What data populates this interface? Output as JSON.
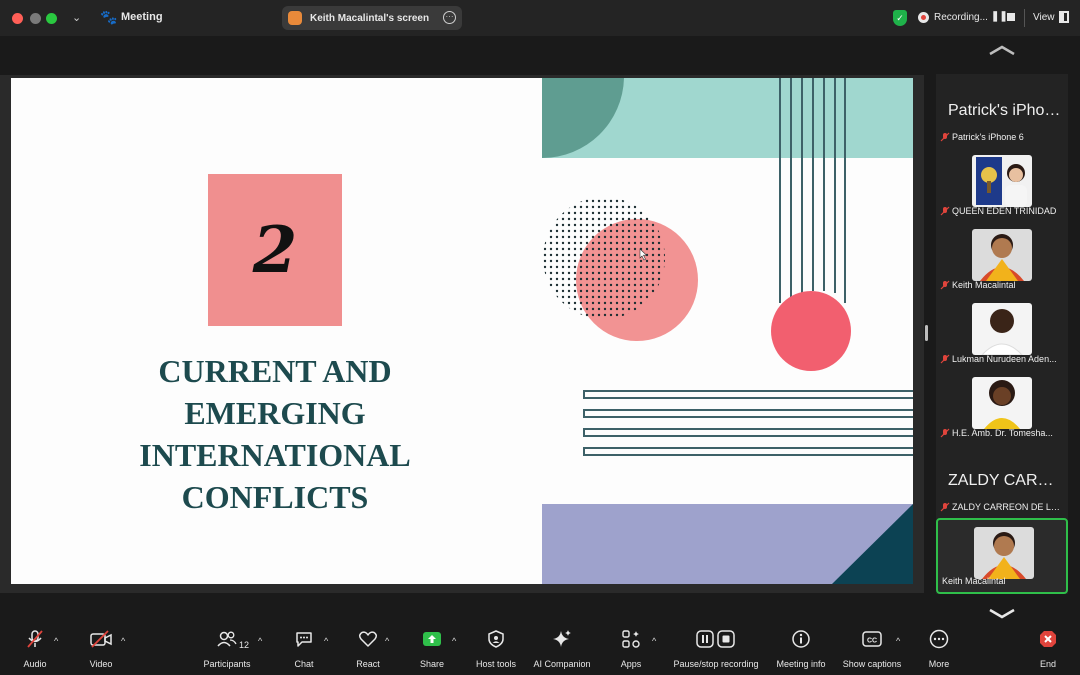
{
  "titlebar": {
    "app_title": "Meeting",
    "screen_pill_label": "Keith Macalintal's screen",
    "recording_label": "Recording...",
    "pause_glyph": "❚❚",
    "view_label": "View",
    "icons": [
      "paw-icon",
      "shield-icon",
      "record-dot-icon",
      "pause-icon",
      "stop-icon",
      "view-layout-icon",
      "more-icon"
    ]
  },
  "slide": {
    "number": "2",
    "title_lines": [
      "CURRENT AND",
      "EMERGING",
      "INTERNATIONAL",
      "CONFLICTS"
    ],
    "colors": {
      "teal_light": "#a0d7cf",
      "teal_dark": "#5f9d91",
      "salmon": "#f29393",
      "coral": "#f25f6f",
      "lavender": "#9ea2cc",
      "navy": "#0c4253",
      "line": "#3d6168",
      "title": "#1d4a4e"
    }
  },
  "gallery": {
    "tiles": [
      {
        "big_name": "Patrick's iPhon...",
        "name": "Patrick's iPhone 6",
        "has_photo": false
      },
      {
        "name": "QUEEN EDEN TRINIDAD",
        "has_photo": true,
        "photo": "portrait-photo-1"
      },
      {
        "name": "Keith Macalintal",
        "has_photo": true,
        "photo": "portrait-photo-2"
      },
      {
        "name": "Lukman Nurudeen Aden...",
        "has_photo": true,
        "photo": "portrait-photo-3"
      },
      {
        "name": "H.E. Amb. Dr. Tomesha...",
        "has_photo": true,
        "photo": "portrait-photo-4"
      },
      {
        "big_name": "ZALDY CARRE...",
        "name": "ZALDY CARREON DE LE...",
        "has_photo": false
      },
      {
        "name": "Keith Macalintal",
        "has_photo": true,
        "photo": "portrait-photo-2",
        "active": true
      }
    ],
    "active_border_color": "#2fbf4a"
  },
  "toolbar": {
    "audio": "Audio",
    "video": "Video",
    "participants": "Participants",
    "participants_count": "12",
    "chat": "Chat",
    "react": "React",
    "share": "Share",
    "host_tools": "Host tools",
    "ai_companion": "AI Companion",
    "apps": "Apps",
    "pause_stop_recording": "Pause/stop recording",
    "meeting_info": "Meeting info",
    "show_captions": "Show captions",
    "captions_glyph": "CC",
    "more": "More",
    "end": "End",
    "accent_share": "#2fbf4a",
    "accent_end": "#e0443c"
  }
}
